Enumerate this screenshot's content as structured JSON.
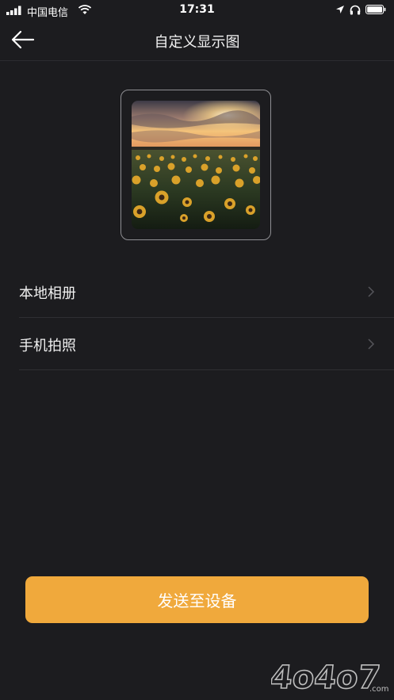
{
  "status_bar": {
    "carrier": "中国电信",
    "time": "17:31"
  },
  "nav": {
    "title": "自定义显示图",
    "back_icon": "arrow-left-icon"
  },
  "preview": {
    "image": "sunflower-field-at-sunset"
  },
  "options": [
    {
      "label": "本地相册",
      "icon": "chevron-right-icon"
    },
    {
      "label": "手机拍照",
      "icon": "chevron-right-icon"
    }
  ],
  "send_button": {
    "label": "发送至设备"
  },
  "watermark": {
    "text": "4o4o7",
    "suffix": ".com"
  },
  "colors": {
    "background": "#1c1c1f",
    "accent": "#f0a93c",
    "text": "#ffffff"
  }
}
